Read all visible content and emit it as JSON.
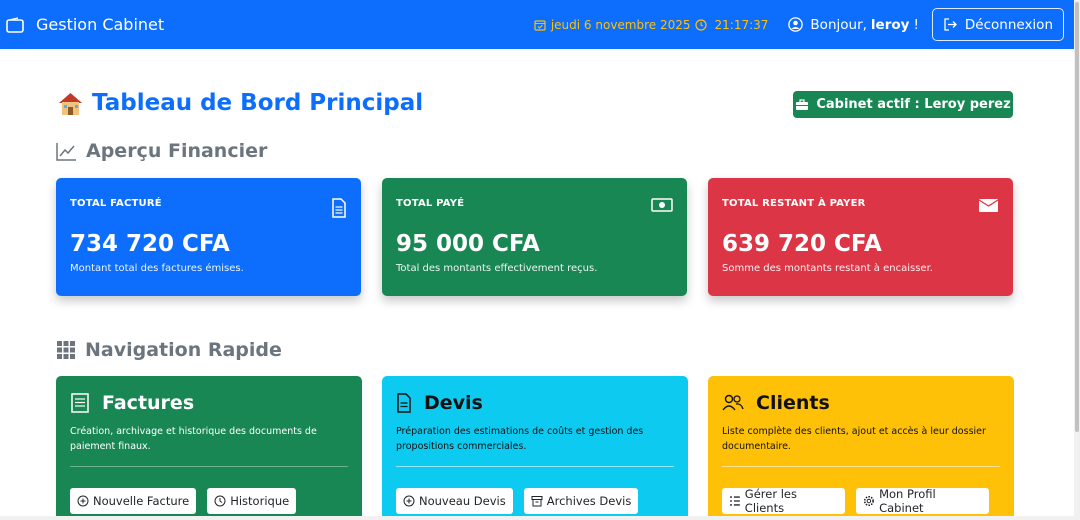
{
  "navbar": {
    "brand": "Gestion Cabinet",
    "date": "jeudi 6 novembre 2025",
    "time": "21:17:37",
    "greeting_prefix": "Bonjour,",
    "username": "leroy",
    "greeting_suffix": "!",
    "logout_label": "Déconnexion"
  },
  "header": {
    "title": "Tableau de Bord Principal",
    "cabinet_badge": "Cabinet actif : Leroy perez"
  },
  "sections": {
    "financial": "Aperçu Financier",
    "navigation": "Navigation Rapide"
  },
  "stats": [
    {
      "label": "TOTAL FACTURÉ",
      "value": "734 720 CFA",
      "desc": "Montant total des factures émises.",
      "color": "#0d6efd",
      "icon": "invoice-icon"
    },
    {
      "label": "TOTAL PAYÉ",
      "value": "95 000 CFA",
      "desc": "Total des montants effectivement reçus.",
      "color": "#198754",
      "icon": "cash-icon"
    },
    {
      "label": "TOTAL RESTANT À PAYER",
      "value": "639 720 CFA",
      "desc": "Somme des montants restant à encaisser.",
      "color": "#dc3545",
      "icon": "envelope-icon"
    }
  ],
  "nav_cards": [
    {
      "title": "Factures",
      "desc": "Création, archivage et historique des documents de paiement finaux.",
      "buttons": [
        "Nouvelle Facture",
        "Historique"
      ],
      "color": "#198754"
    },
    {
      "title": "Devis",
      "desc": "Préparation des estimations de coûts et gestion des propositions commerciales.",
      "buttons": [
        "Nouveau Devis",
        "Archives Devis"
      ],
      "color": "#0dcaf0"
    },
    {
      "title": "Clients",
      "desc": "Liste complète des clients, ajout et accès à leur dossier documentaire.",
      "buttons": [
        "Gérer les Clients",
        "Mon Profil Cabinet"
      ],
      "color": "#ffc107"
    }
  ]
}
